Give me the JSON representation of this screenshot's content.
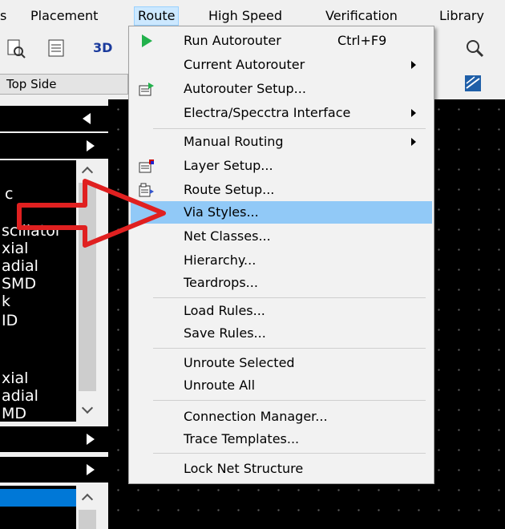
{
  "menubar": {
    "items": [
      {
        "label": "s"
      },
      {
        "label": "Placement"
      },
      {
        "label": "Route"
      },
      {
        "label": "High Speed"
      },
      {
        "label": "Verification"
      },
      {
        "label": "Library"
      }
    ]
  },
  "toolbar": {
    "btn_3d": "3D"
  },
  "layer_combo": {
    "value": "Top Side"
  },
  "left_panel": {
    "list1": [
      "c",
      "scillator",
      "xial",
      "adial",
      "SMD",
      "k",
      "ID"
    ],
    "list2": [
      "xial",
      "adial",
      "MD"
    ]
  },
  "route_menu": {
    "items": [
      {
        "label": "Run Autorouter",
        "shortcut": "Ctrl+F9",
        "icon": "play-icon"
      },
      {
        "label": "Current Autorouter",
        "submenu": true
      },
      {
        "label": "Autorouter Setup...",
        "icon": "autorouter-setup-icon"
      },
      {
        "label": "Electra/Specctra Interface",
        "submenu": true
      },
      {
        "label": "Manual Routing",
        "submenu": true
      },
      {
        "label": "Layer Setup...",
        "icon": "layer-setup-icon"
      },
      {
        "label": "Route Setup...",
        "icon": "route-setup-icon"
      },
      {
        "label": "Via Styles...",
        "highlighted": true
      },
      {
        "label": "Net Classes..."
      },
      {
        "label": "Hierarchy..."
      },
      {
        "label": "Teardrops..."
      },
      {
        "label": "Load Rules..."
      },
      {
        "label": "Save Rules..."
      },
      {
        "label": "Unroute Selected"
      },
      {
        "label": "Unroute All"
      },
      {
        "label": "Connection Manager..."
      },
      {
        "label": "Trace Templates..."
      },
      {
        "label": "Lock Net Structure"
      }
    ]
  },
  "colors": {
    "highlight": "#91c9f7",
    "arrow": "#e02020",
    "play": "#22b14c"
  }
}
